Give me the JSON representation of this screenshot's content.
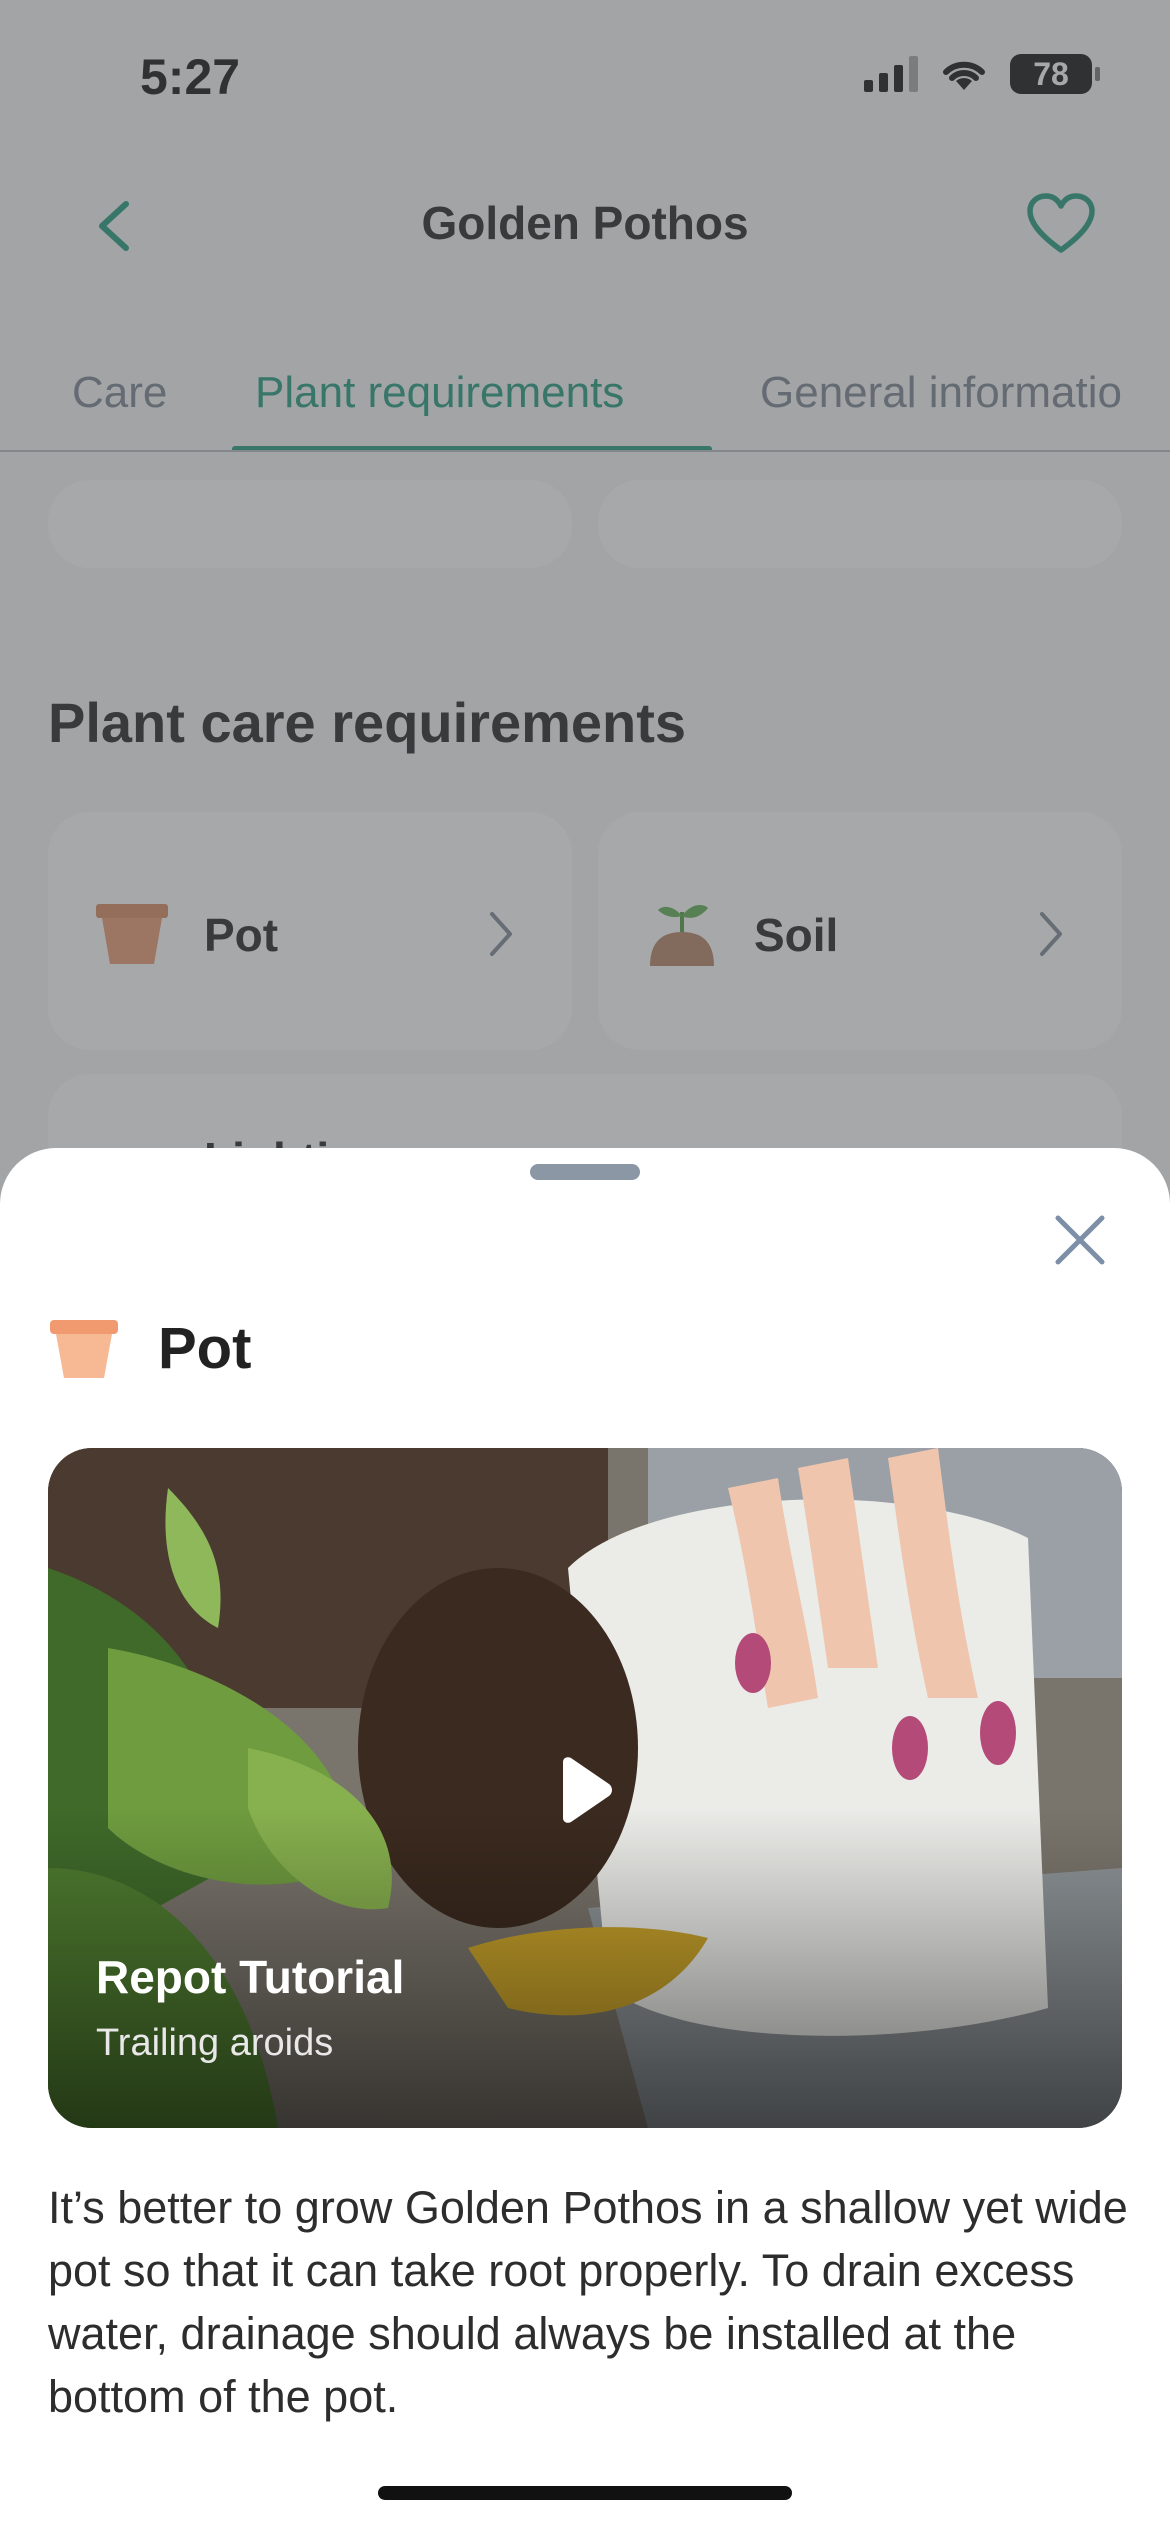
{
  "status_bar": {
    "time": "5:27",
    "battery": "78"
  },
  "nav": {
    "title": "Golden Pothos",
    "back_icon": "chevron-left-icon",
    "favorite_icon": "heart-icon"
  },
  "tabs": [
    "Care",
    "Plant requirements",
    "General informatio"
  ],
  "active_tab": "Plant requirements",
  "section": {
    "title": "Plant care requirements"
  },
  "requirements": [
    {
      "label": "Pot",
      "icon": "pot-icon"
    },
    {
      "label": "Soil",
      "icon": "soil-icon"
    },
    {
      "label": "Lighting",
      "icon": "light-icon"
    }
  ],
  "sheet": {
    "title": "Pot",
    "icon": "pot-icon",
    "video": {
      "title": "Repot Tutorial",
      "subtitle": "Trailing aroids"
    },
    "description": "It’s better to grow Golden Pothos in a shallow yet wide pot so that it can take root properly. To drain excess water, drainage should always be installed at the bottom of the pot."
  },
  "colors": {
    "accent": "#1f9b7d",
    "pot": "#f4a57e"
  }
}
